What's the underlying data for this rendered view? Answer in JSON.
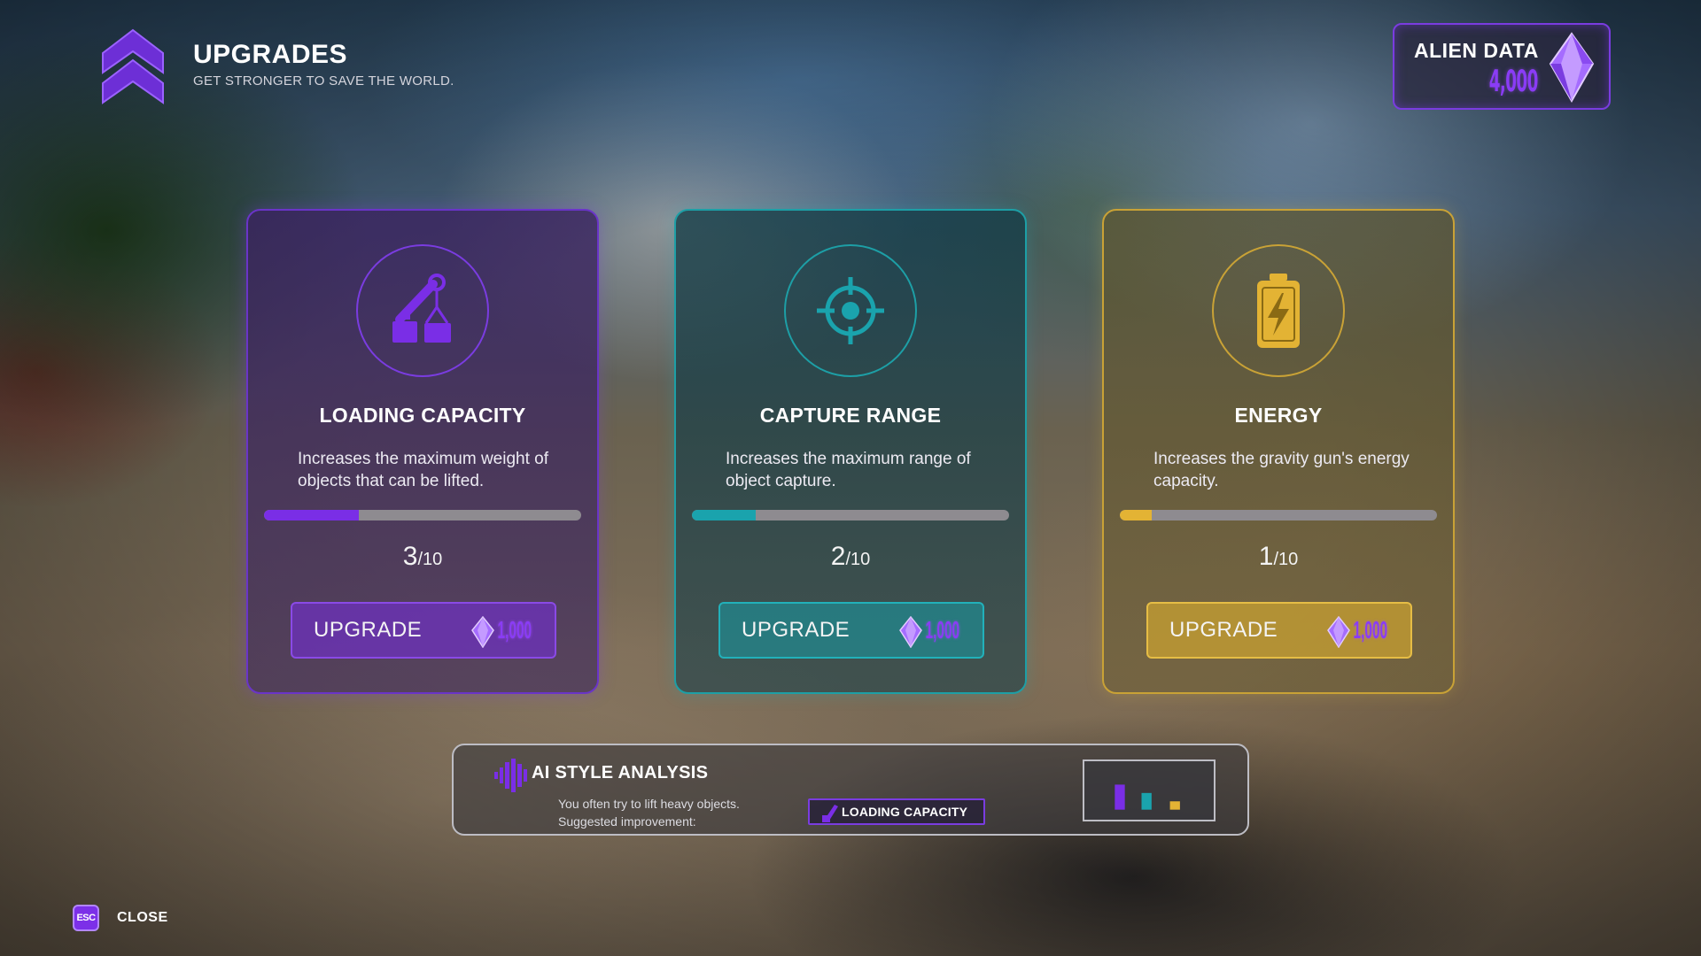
{
  "header": {
    "title": "UPGRADES",
    "subtitle": "GET STRONGER TO SAVE THE WORLD.",
    "icon": "double-chevron-up-icon"
  },
  "currency": {
    "label": "ALIEN DATA",
    "value": "4,000",
    "icon": "crystal-gem-icon"
  },
  "colors": {
    "purple": "#7a3ce0",
    "teal": "#1d9fa6",
    "gold": "#c9a236"
  },
  "cards": [
    {
      "title": "LOADING CAPACITY",
      "description": "Increases the maximum weight of objects that can be lifted.",
      "level": "3",
      "max": "/10",
      "progress": 0.3,
      "button_label": "UPGRADE",
      "cost": "1,000",
      "icon": "crane-icon",
      "accent": "#7a3ce0"
    },
    {
      "title": "CAPTURE RANGE",
      "description": "Increases the maximum range of object capture.",
      "level": "2",
      "max": "/10",
      "progress": 0.2,
      "button_label": "UPGRADE",
      "cost": "1,000",
      "icon": "crosshair-icon",
      "accent": "#1d9fa6"
    },
    {
      "title": "ENERGY",
      "description": "Increases the gravity gun's energy capacity.",
      "level": "1",
      "max": "/10",
      "progress": 0.1,
      "button_label": "UPGRADE",
      "cost": "1,000",
      "icon": "battery-bolt-icon",
      "accent": "#c9a236"
    }
  ],
  "ai_panel": {
    "title": "AI STYLE ANALYSIS",
    "line1": "You often try to lift heavy objects.",
    "line2": "Suggested improvement:",
    "suggestion": "LOADING CAPACITY",
    "icon": "waveform-icon",
    "chart_levels": [
      3,
      2,
      1
    ]
  },
  "close": {
    "key": "ESC",
    "label": "CLOSE"
  }
}
